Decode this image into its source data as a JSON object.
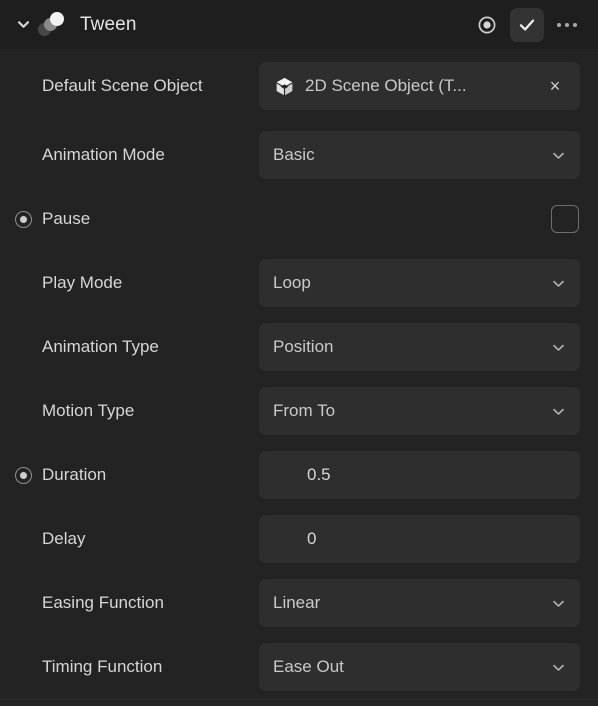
{
  "header": {
    "title": "Tween",
    "collapse_icon": "chevron-down-icon",
    "component_icon": "tween-circles-icon",
    "record_icon": "record-keyframe-icon",
    "enabled_icon": "check-icon",
    "more_icon": "more-options-icon",
    "enabled": true
  },
  "colors": {
    "panel_bg": "#232323",
    "header_bg": "#1e1e1e",
    "field_bg": "#2e2e2e",
    "text": "#d6d6d6",
    "muted_text": "#c9c9c9",
    "accent_active": "#333333",
    "border": "#6e6e6e"
  },
  "rows": [
    {
      "label": "Default Scene Object",
      "type": "object",
      "value": "2D Scene Object (T...",
      "icon": "cube-icon",
      "clear_label": "×",
      "keyframe": false
    },
    {
      "label": "Animation Mode",
      "type": "dropdown",
      "value": "Basic",
      "keyframe": false
    },
    {
      "label": "Pause",
      "type": "checkbox",
      "value": "",
      "checked": false,
      "keyframe": true
    },
    {
      "label": "Play Mode",
      "type": "dropdown",
      "value": "Loop",
      "keyframe": false
    },
    {
      "label": "Animation Type",
      "type": "dropdown",
      "value": "Position",
      "keyframe": false
    },
    {
      "label": "Motion Type",
      "type": "dropdown",
      "value": "From To",
      "keyframe": false
    },
    {
      "label": "Duration",
      "type": "number",
      "value": "0.5",
      "keyframe": true
    },
    {
      "label": "Delay",
      "type": "number",
      "value": "0",
      "keyframe": false
    },
    {
      "label": "Easing Function",
      "type": "dropdown",
      "value": "Linear",
      "keyframe": false
    },
    {
      "label": "Timing Function",
      "type": "dropdown",
      "value": "Ease Out",
      "keyframe": false
    }
  ]
}
